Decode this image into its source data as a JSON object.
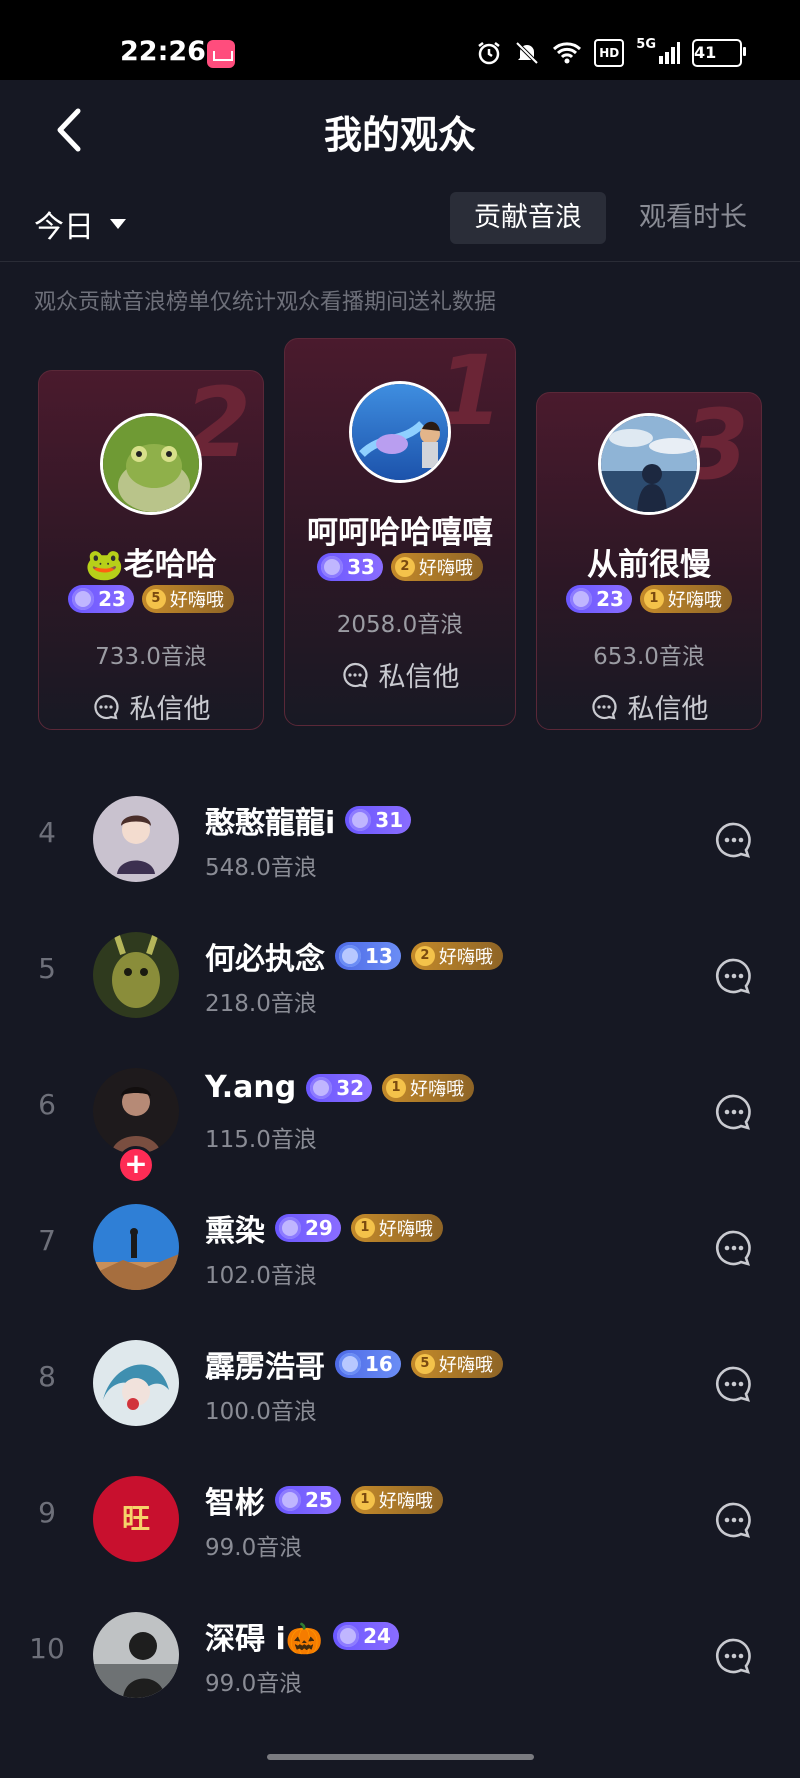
{
  "status_bar": {
    "time": "22:26",
    "hd": "HD",
    "network": "5G",
    "battery": "41"
  },
  "header": {
    "title": "我的观众"
  },
  "filter": {
    "date_label": "今日",
    "tabs": [
      {
        "label": "贡献音浪",
        "active": true
      },
      {
        "label": "观看时长",
        "active": false
      }
    ]
  },
  "notice": "观众贡献音浪榜单仅统计观众看播期间送礼数据",
  "dm_label": "私信他",
  "podium": [
    {
      "rank": "2",
      "name": "🐸老哈哈",
      "level": "23",
      "fan_level": "5",
      "fan_label": "好嗨哦",
      "amount": "733.0音浪"
    },
    {
      "rank": "1",
      "name": "呵呵哈哈嘻嘻",
      "level": "33",
      "fan_level": "2",
      "fan_label": "好嗨哦",
      "amount": "2058.0音浪"
    },
    {
      "rank": "3",
      "name": "从前很慢",
      "level": "23",
      "fan_level": "1",
      "fan_label": "好嗨哦",
      "amount": "653.0音浪"
    }
  ],
  "list": [
    {
      "rank": "4",
      "name": "憨憨龍龍i",
      "level": "31",
      "level_style": "purple",
      "fan_level": null,
      "fan_label": null,
      "amount": "548.0音浪"
    },
    {
      "rank": "5",
      "name": "何必执念",
      "level": "13",
      "level_style": "blue",
      "fan_level": "2",
      "fan_label": "好嗨哦",
      "amount": "218.0音浪"
    },
    {
      "rank": "6",
      "name": "Y.ang",
      "level": "32",
      "level_style": "purple",
      "fan_level": "1",
      "fan_label": "好嗨哦",
      "amount": "115.0音浪"
    },
    {
      "rank": "7",
      "name": "熏染",
      "level": "29",
      "level_style": "purple",
      "fan_level": "1",
      "fan_label": "好嗨哦",
      "amount": "102.0音浪"
    },
    {
      "rank": "8",
      "name": "霹雳浩哥",
      "level": "16",
      "level_style": "blue",
      "fan_level": "5",
      "fan_label": "好嗨哦",
      "amount": "100.0音浪"
    },
    {
      "rank": "9",
      "name": "智彬",
      "level": "25",
      "level_style": "purple",
      "fan_level": "1",
      "fan_label": "好嗨哦",
      "amount": "99.0音浪"
    },
    {
      "rank": "10",
      "name": "深碍 i🎃",
      "level": "24",
      "level_style": "purple",
      "fan_level": null,
      "fan_label": null,
      "amount": "99.0音浪"
    }
  ],
  "avatar_9_text": "旺",
  "plus_badge": "+"
}
